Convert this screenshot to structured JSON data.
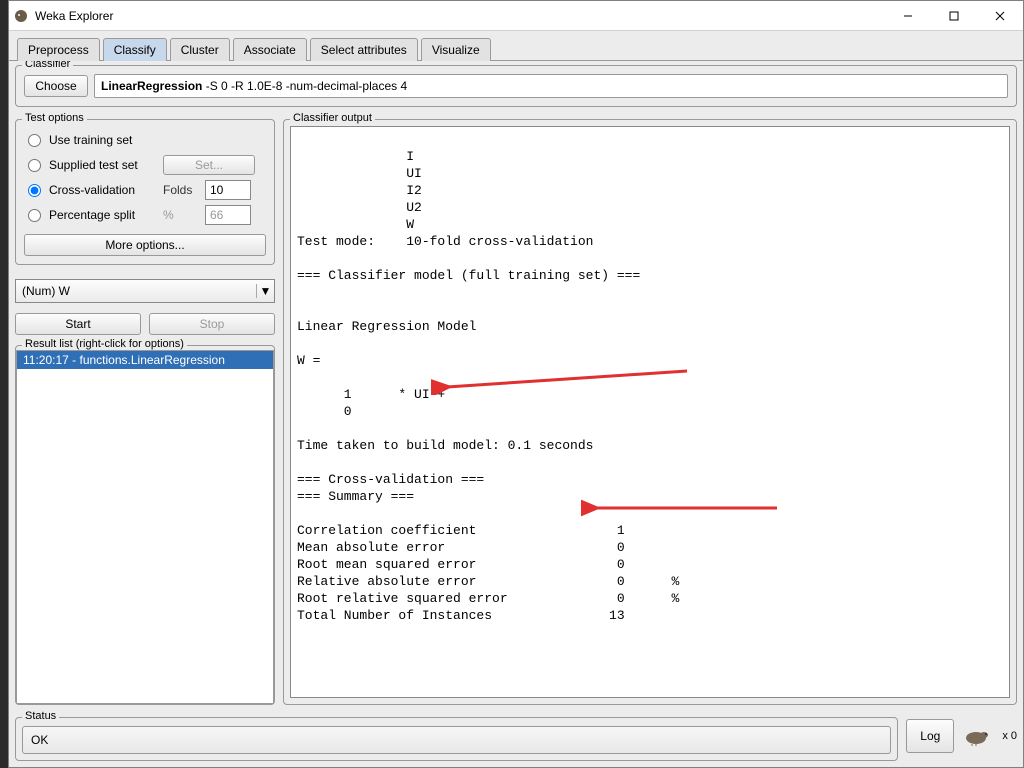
{
  "window": {
    "title": "Weka Explorer"
  },
  "tabs": [
    "Preprocess",
    "Classify",
    "Cluster",
    "Associate",
    "Select attributes",
    "Visualize"
  ],
  "active_tab": 1,
  "classifier": {
    "legend": "Classifier",
    "choose": "Choose",
    "name": "LinearRegression",
    "args": "-S 0 -R 1.0E-8 -num-decimal-places 4"
  },
  "test_options": {
    "legend": "Test options",
    "items": {
      "use_training": "Use training set",
      "supplied": "Supplied test set",
      "set_btn": "Set...",
      "crossval": "Cross-validation",
      "folds_lbl": "Folds",
      "folds_val": "10",
      "pct_split": "Percentage split",
      "pct_lbl": "%",
      "pct_val": "66"
    },
    "more": "More options..."
  },
  "class_attr": "(Num) W",
  "start": "Start",
  "stop": "Stop",
  "result_list": {
    "legend": "Result list (right-click for options)",
    "items": [
      "11:20:17 - functions.LinearRegression"
    ]
  },
  "output": {
    "legend": "Classifier output",
    "text": "              I\n              UI\n              I2\n              U2\n              W\nTest mode:    10-fold cross-validation\n\n=== Classifier model (full training set) ===\n\n\nLinear Regression Model\n\nW =\n\n      1      * UI +\n      0     \n\nTime taken to build model: 0.1 seconds\n\n=== Cross-validation ===\n=== Summary ===\n\nCorrelation coefficient                  1     \nMean absolute error                      0     \nRoot mean squared error                  0     \nRelative absolute error                  0      %\nRoot relative squared error              0      %\nTotal Number of Instances               13     \n"
  },
  "status": {
    "legend": "Status",
    "value": "OK",
    "log": "Log",
    "count": "x 0"
  }
}
